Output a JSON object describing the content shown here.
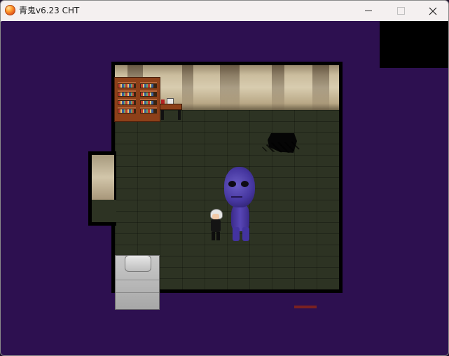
{
  "window": {
    "title": "青鬼v6.23 CHT",
    "controls": {
      "minimize": "minimize",
      "maximize": "maximize",
      "close": "close"
    }
  },
  "icons": {
    "app": "app-orb-icon",
    "minimize": "minimize-icon",
    "maximize": "maximize-icon",
    "close": "close-icon"
  },
  "colors": {
    "background": "#2d1050",
    "floor": "#2d3323",
    "wall": "#d8ccaf",
    "furniture": "#8d4019",
    "ao_oni": "#4637a0"
  },
  "scene": {
    "sprites": [
      "player",
      "ao-oni",
      "bookcase",
      "desk",
      "bed",
      "floor-hole"
    ]
  }
}
